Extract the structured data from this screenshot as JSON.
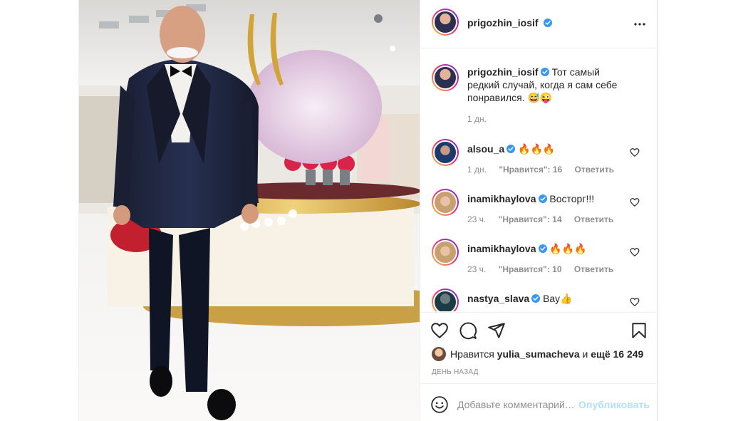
{
  "post": {
    "author": "prigozhin_iosif",
    "caption": {
      "text": "Тот самый редкий случай, когда я сам себе понравился. 😅😜",
      "age": "1 дн."
    },
    "header_icons": {
      "verified": "verified-badge-icon",
      "more": "more-options-icon"
    }
  },
  "labels": {
    "likes_word": "Нравится",
    "reply": "Ответить"
  },
  "comments": [
    {
      "user": "alsou_a",
      "text": "🔥🔥🔥",
      "age": "1 дн.",
      "likes": "\"Нравится\": 16"
    },
    {
      "user": "inamikhaylova",
      "text": "Восторг!!!",
      "age": "23 ч.",
      "likes": "\"Нравится\": 14"
    },
    {
      "user": "inamikhaylova",
      "text": "🔥🔥🔥",
      "age": "23 ч.",
      "likes": "\"Нравится\": 10"
    },
    {
      "user": "nastya_slava",
      "text": "Вау👍",
      "age": "",
      "likes": ""
    }
  ],
  "actions": {
    "icons": [
      "heart-icon",
      "comment-icon",
      "share-icon",
      "bookmark-icon"
    ]
  },
  "likes": {
    "prefix": "Нравится",
    "user": "yulia_sumacheva",
    "middle": "и",
    "count": "ещё 16 249"
  },
  "timestamp": "ДЕНЬ НАЗАД",
  "add_comment": {
    "placeholder": "Добавьте комментарий…",
    "publish": "Опубликовать"
  },
  "colors": {
    "link_disabled": "#b2dffc",
    "verified": "#3897f0",
    "secondary_text": "#8e8e8e",
    "primary_text": "#262626"
  }
}
